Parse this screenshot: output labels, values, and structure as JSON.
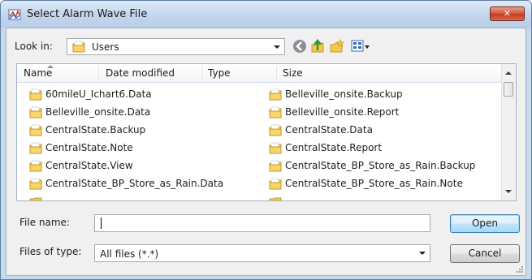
{
  "window": {
    "title": "Select Alarm Wave File",
    "close_symbol": "✕"
  },
  "toolbar": {
    "look_in_label": "Look in:",
    "look_in_value": "Users",
    "icons": [
      "back-icon",
      "up-folder-icon",
      "new-folder-icon",
      "view-menu-icon"
    ]
  },
  "columns": {
    "name": "Name",
    "date_modified": "Date modified",
    "type": "Type",
    "size": "Size"
  },
  "files": [
    "60mileU_Ichart6.Data",
    "Belleville_onsite.Backup",
    "Belleville_onsite.Data",
    "Belleville_onsite.Report",
    "CentralState.Backup",
    "CentralState.Data",
    "CentralState.Note",
    "CentralState.Report",
    "CentralState.View",
    "CentralState_BP_Store_as_Rain.Backup",
    "CentralState_BP_Store_as_Rain.Data",
    "CentralState_BP_Store_as_Rain.Note"
  ],
  "file_name": {
    "label": "File name:",
    "value": ""
  },
  "file_type": {
    "label": "Files of type:",
    "value": "All files (*.*)"
  },
  "buttons": {
    "open": "Open",
    "cancel": "Cancel"
  },
  "colors": {
    "title_bar": "#c5d7ee",
    "close_button": "#d4553a",
    "folder": "#f3c94c",
    "default_button_border": "#3c7fb1"
  }
}
